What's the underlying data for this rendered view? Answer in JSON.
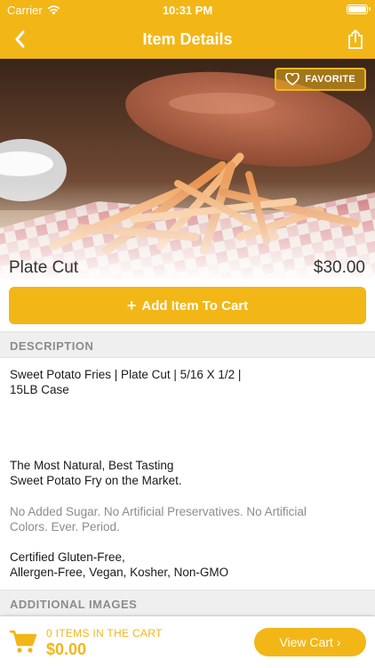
{
  "status_bar": {
    "carrier": "Carrier",
    "time": "10:31 PM"
  },
  "nav": {
    "title": "Item Details",
    "back_icon": "chevron-left-icon",
    "share_icon": "share-icon"
  },
  "hero": {
    "favorite_label": "FAVORITE",
    "favorite_icon": "heart-icon"
  },
  "item": {
    "name": "Plate Cut",
    "price": "$30.00"
  },
  "add_to_cart": {
    "label": "Add Item To Cart",
    "icon": "+"
  },
  "description": {
    "header": "DESCRIPTION",
    "line1": "Sweet Potato Fries | Plate Cut | 5/16 X 1/2 |",
    "line2": "15LB Case",
    "line3": "The Most Natural, Best Tasting",
    "line4": "Sweet Potato Fry on the Market.",
    "line5": "No Added Sugar. No Artificial Preservatives. No Artificial",
    "line6": "Colors. Ever. Period.",
    "line7": "Certified Gluten-Free,",
    "line8": "Allergen-Free, Vegan, Kosher, Non-GMO"
  },
  "additional_images": {
    "header": "ADDITIONAL IMAGES"
  },
  "cart_bar": {
    "count_label": "0 ITEMS IN THE CART",
    "total": "$0.00",
    "view_cart_label": "View Cart",
    "view_cart_icon": "›"
  },
  "colors": {
    "accent": "#f2b617",
    "muted_text": "#8c8c8c",
    "section_bg": "#efefef"
  }
}
